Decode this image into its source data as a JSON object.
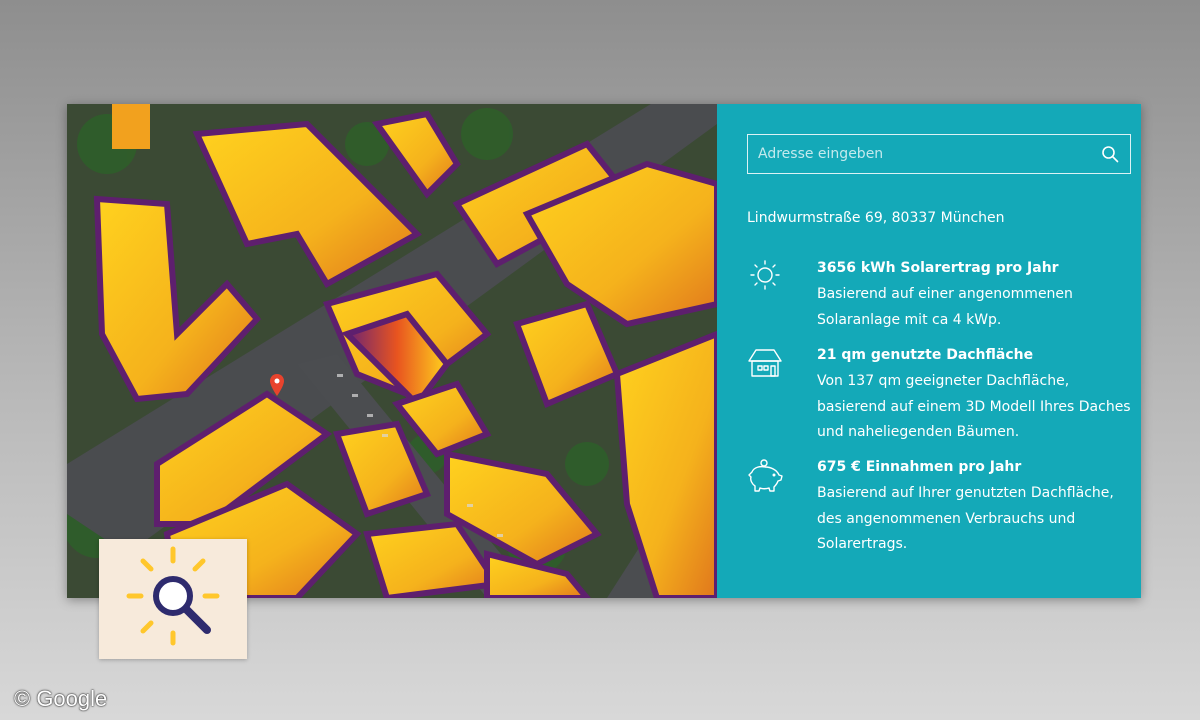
{
  "search": {
    "placeholder": "Adresse eingeben",
    "icon": "search-icon"
  },
  "address": "Lindwurmstraße 69, 80337 München",
  "stats": [
    {
      "icon": "sun-icon",
      "title": "3656 kWh Solarertrag pro Jahr",
      "lines": [
        "Basierend auf einer angenommenen",
        "Solaranlage mit ca 4 kWp."
      ]
    },
    {
      "icon": "house-icon",
      "title": "21 qm genutzte Dachfläche",
      "lines": [
        "Von 137 qm geeigneter Dachfläche,",
        "basierend auf einem 3D Modell Ihres Daches",
        "und naheliegenden Bäumen."
      ]
    },
    {
      "icon": "piggy-bank-icon",
      "title": "675 € Einnahmen pro Jahr",
      "lines": [
        "Basierend auf Ihrer genutzten Dachfläche,",
        "des angenommenen Verbrauchs und",
        "Solarertrags."
      ]
    }
  ],
  "colors": {
    "panel": "#14a9b8",
    "roof_high": "#ffd21e",
    "roof_mid": "#f08a1c",
    "roof_low": "#5e1f6e",
    "marker": "#e8432d"
  },
  "copyright": "© Google"
}
